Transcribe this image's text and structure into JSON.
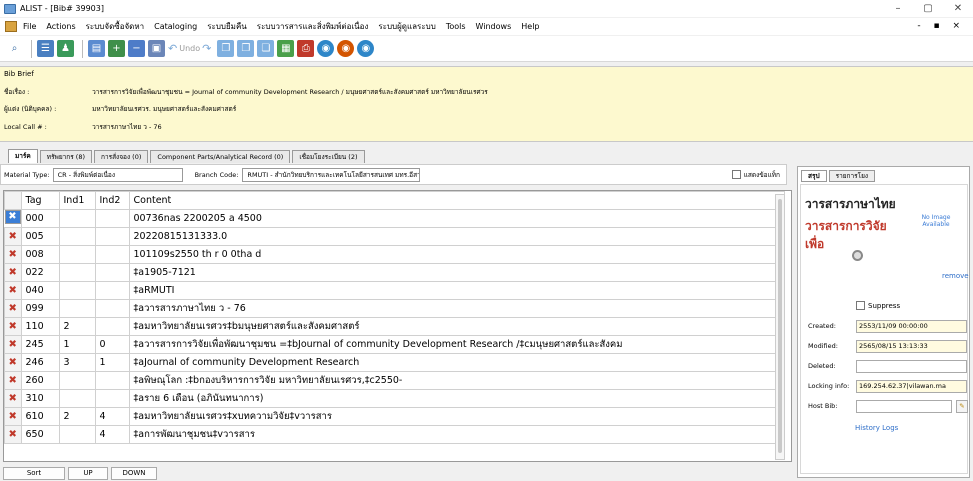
{
  "window": {
    "title": "ALIST - [Bib# 39903]",
    "controls": [
      "–",
      "▢",
      "✕"
    ]
  },
  "menu": {
    "items": [
      "File",
      "Actions",
      "ระบบจัดซื้อจัดหา",
      "Cataloging",
      "ระบบยืมคืน",
      "ระบบวารสารและสิ่งพิมพ์ต่อเนื่อง",
      "ระบบผู้ดูแลระบบ",
      "Tools",
      "Windows",
      "Help"
    ],
    "right": "- ▪ ×"
  },
  "toolbar": {
    "undo_label": "Undo"
  },
  "brief": {
    "header": "Bib Brief",
    "title_label": "ชื่อเรื่อง :",
    "title_value": "วารสารการวิจัยเพื่อพัฒนาชุมชน = Journal of community Development Research / มนุษยศาสตร์และสังคมศาสตร์ มหาวิทยาลัยนเรศวร",
    "author_label": "ผู้แต่ง (นิติบุคคล) :",
    "author_value": "มหาวิทยาลัยนเรศวร. มนุษยศาสตร์และสังคมศาสตร์",
    "callno_label": "Local Call # :",
    "callno_value": "วารสารภาษาไทย ว - 76"
  },
  "tabs": [
    "มาร์ค",
    "ทรัพยากร (8)",
    "การสั่งจอง (0)",
    "Component Parts/Analytical Record (0)",
    "เชื่อมโยงระเบียน (2)"
  ],
  "filter": {
    "material_label": "Material Type:",
    "material_value": "CR - สิ่งพิมพ์ต่อเนื่อง",
    "branch_label": "Branch Code:",
    "branch_value": "RMUTI - สำนักวิทยบริการและเทคโนโลยีสารสนเทศ มทร.อีสาน",
    "checkbox_label": "แสดงข้อแท็ก"
  },
  "grid": {
    "headers": [
      "Tag",
      "Ind1",
      "Ind2",
      "Content"
    ],
    "rows": [
      {
        "tag": "000",
        "ind1": "",
        "ind2": "",
        "content": "00736nas 2200205 a 4500"
      },
      {
        "tag": "005",
        "ind1": "",
        "ind2": "",
        "content": "20220815131333.0"
      },
      {
        "tag": "008",
        "ind1": "",
        "ind2": "",
        "content": "101109s2550   th r      0   0tha d"
      },
      {
        "tag": "022",
        "ind1": "",
        "ind2": "",
        "content": "‡a1905-7121"
      },
      {
        "tag": "040",
        "ind1": "",
        "ind2": "",
        "content": "‡aRMUTI"
      },
      {
        "tag": "099",
        "ind1": "",
        "ind2": "",
        "content": "‡aวารสารภาษาไทย ว - 76"
      },
      {
        "tag": "110",
        "ind1": "2",
        "ind2": "",
        "content": "‡aมหาวิทยาลัยนเรศวร‡bมนุษยศาสตร์และสังคมศาสตร์"
      },
      {
        "tag": "245",
        "ind1": "1",
        "ind2": "0",
        "content": "‡aวารสารการวิจัยเพื่อพัฒนาชุมชน =‡bJournal of community Development Research /‡cมนุษยศาสตร์และสังคม"
      },
      {
        "tag": "246",
        "ind1": "3",
        "ind2": "1",
        "content": "‡aJournal of community Development Research"
      },
      {
        "tag": "260",
        "ind1": "",
        "ind2": "",
        "content": "‡aพิษณุโลก :‡bกองบริหารการวิจัย มหาวิทยาลัยนเรศวร,‡c2550-"
      },
      {
        "tag": "310",
        "ind1": "",
        "ind2": "",
        "content": "‡aราย 6 เดือน (อภินันทนาการ)"
      },
      {
        "tag": "610",
        "ind1": "2",
        "ind2": "4",
        "content": "‡aมหาวิทยาลัยนเรศวร‡xบทความวิจัย‡vวารสาร"
      },
      {
        "tag": "650",
        "ind1": "",
        "ind2": "4",
        "content": "‡aการพัฒนาชุมชน‡vวารสาร"
      }
    ]
  },
  "bottom": {
    "sort": "Sort",
    "up": "UP",
    "down": "DOWN"
  },
  "right_panel": {
    "tabs": [
      "สรุป",
      "รายการโยง"
    ],
    "title": "วารสารภาษาไทย",
    "subtitle": "วารสารการวิจัยเพื่อ",
    "no_image": "No Image Available",
    "remove": "remove",
    "suppress_label": "Suppress",
    "created_label": "Created:",
    "created_value": "2553/11/09 00:00:00",
    "modified_label": "Modified:",
    "modified_value": "2565/08/15 13:13:33",
    "deleted_label": "Deleted:",
    "deleted_value": "",
    "locking_label": "Locking info:",
    "locking_value": "169.254.62.37|vilawan.ma",
    "hostbib_label": "Host Bib:",
    "hostbib_value": "",
    "history": "History Logs"
  }
}
